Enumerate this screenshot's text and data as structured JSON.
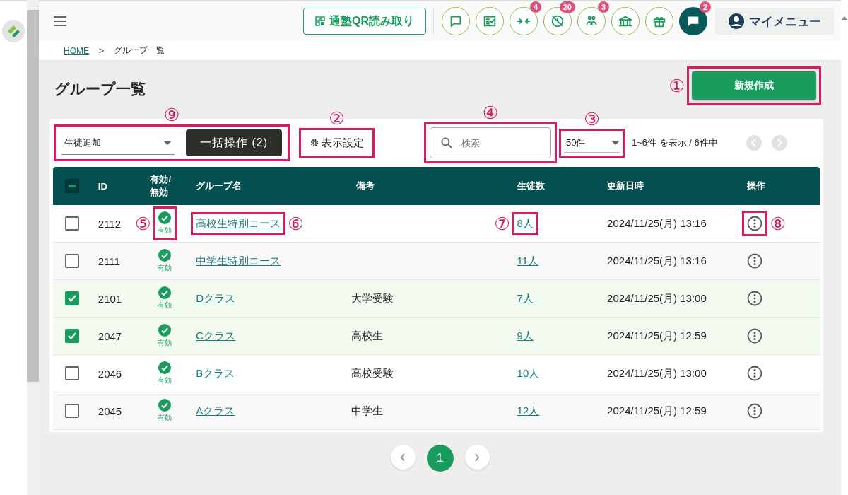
{
  "header": {
    "qr_button": "通塾QR読み取り",
    "icon_buttons": [
      {
        "kind": "outline"
      },
      {
        "kind": "outline"
      },
      {
        "kind": "outline",
        "badge": "4"
      },
      {
        "kind": "outline",
        "badge": "20"
      },
      {
        "kind": "outline",
        "badge": "3"
      },
      {
        "kind": "outline"
      },
      {
        "kind": "outline"
      },
      {
        "kind": "filled",
        "badge": "2"
      }
    ],
    "my_menu": "マイメニュー"
  },
  "breadcrumb": {
    "home": "HOME",
    "separator": ">",
    "current": "グループ一覧"
  },
  "page": {
    "title": "グループ一覧",
    "new_button": {
      "label": "新規作成",
      "callout": "①"
    }
  },
  "toolbar": {
    "bulk": {
      "select_value": "生徒追加",
      "button": "一括操作 (2)",
      "callout": "⑨"
    },
    "display_settings": {
      "label": "表示設定",
      "callout": "②"
    },
    "search": {
      "placeholder": "検索",
      "callout": "④"
    },
    "per_page": {
      "value": "50件",
      "callout": "③"
    },
    "range_text": "1~6件 を表示 / 6件中"
  },
  "table": {
    "header_checkbox": {
      "indeterminate": true
    },
    "columns": [
      "ID",
      "有効/無効",
      "グループ名",
      "備考",
      "生徒数",
      "更新日時",
      "操作"
    ],
    "rows": [
      {
        "checked": false,
        "id": "2112",
        "status": {
          "label": "有効",
          "active": true,
          "callout": "⑤"
        },
        "name": {
          "text": "高校生特別コース",
          "callout": "⑥"
        },
        "count": {
          "text": "8人",
          "callout": "⑦"
        },
        "updated": "2024/11/25(月) 13:16",
        "menu_callout": "⑧"
      },
      {
        "checked": false,
        "id": "2111",
        "status": {
          "label": "有効",
          "active": true
        },
        "name": {
          "text": "中学生特別コース"
        },
        "count": {
          "text": "11人"
        },
        "updated": "2024/11/25(月) 13:16"
      },
      {
        "checked": true,
        "id": "2101",
        "status": {
          "label": "有効",
          "active": true
        },
        "name": {
          "text": "Dクラス"
        },
        "note": "大学受験",
        "count": {
          "text": "7人"
        },
        "updated": "2024/11/25(月) 13:00"
      },
      {
        "checked": true,
        "id": "2047",
        "status": {
          "label": "有効",
          "active": true
        },
        "name": {
          "text": "Cクラス"
        },
        "note": "高校生",
        "count": {
          "text": "9人"
        },
        "updated": "2024/11/25(月) 12:59"
      },
      {
        "checked": false,
        "id": "2046",
        "status": {
          "label": "有効",
          "active": true
        },
        "name": {
          "text": "Bクラス"
        },
        "note": "高校受験",
        "count": {
          "text": "10人"
        },
        "updated": "2024/11/25(月) 13:00"
      },
      {
        "checked": false,
        "id": "2045",
        "status": {
          "label": "有効",
          "active": true
        },
        "name": {
          "text": "Aクラス"
        },
        "note": "中学生",
        "count": {
          "text": "12人"
        },
        "updated": "2024/11/25(月) 12:59"
      }
    ]
  },
  "pagination": {
    "pages": [
      {
        "label": "1",
        "selected": true
      }
    ]
  }
}
